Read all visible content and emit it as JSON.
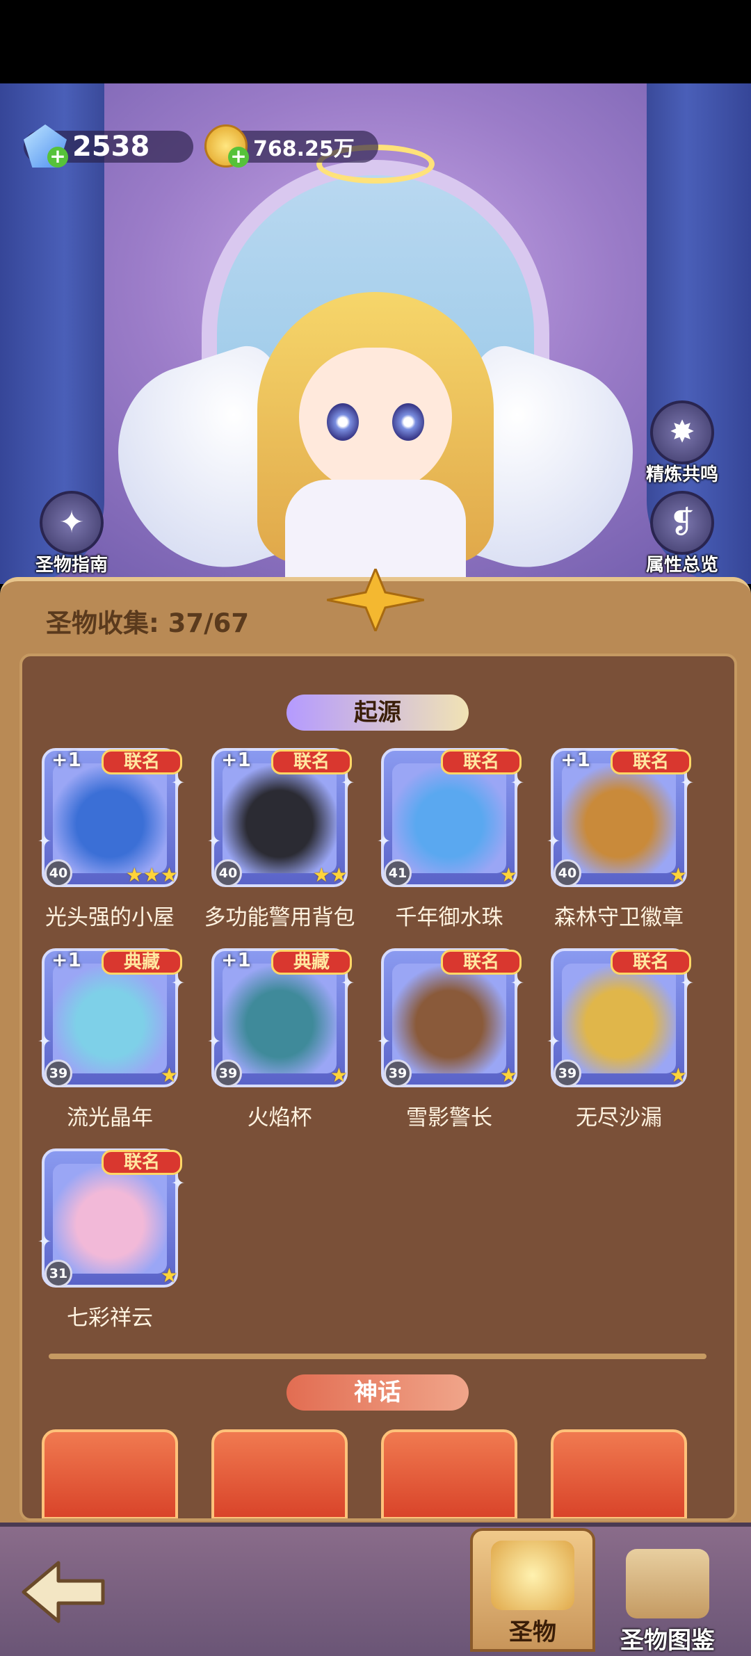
{
  "currency": {
    "diamonds": "2538",
    "coins": "768.25万"
  },
  "side_buttons": {
    "guide": "圣物指南",
    "resonance": "精炼共鸣",
    "overview": "属性总览"
  },
  "collection": {
    "label": "圣物收集: 37/67"
  },
  "categories": {
    "origin": "起源",
    "myth": "神话"
  },
  "items": [
    {
      "name": "光头强的小屋",
      "level": "40",
      "tag": "联名",
      "plus": "+1",
      "stars": "★★★",
      "art_color": "#3b6fd6"
    },
    {
      "name": "多功能警用背包",
      "level": "40",
      "tag": "联名",
      "plus": "+1",
      "stars": "★★",
      "art_color": "#2b2b33"
    },
    {
      "name": "千年御水珠",
      "level": "41",
      "tag": "联名",
      "plus": "",
      "stars": "★",
      "art_color": "#5aa8f0"
    },
    {
      "name": "森林守卫徽章",
      "level": "40",
      "tag": "联名",
      "plus": "+1",
      "stars": "★",
      "art_color": "#c98a3a"
    },
    {
      "name": "流光晶年",
      "level": "39",
      "tag": "典藏",
      "plus": "+1",
      "stars": "★",
      "art_color": "#7ed0e8"
    },
    {
      "name": "火焰杯",
      "level": "39",
      "tag": "典藏",
      "plus": "+1",
      "stars": "★",
      "art_color": "#3f8a9a"
    },
    {
      "name": "雪影警长",
      "level": "39",
      "tag": "联名",
      "plus": "",
      "stars": "★",
      "art_color": "#8a5a3a"
    },
    {
      "name": "无尽沙漏",
      "level": "39",
      "tag": "联名",
      "plus": "",
      "stars": "★",
      "art_color": "#e0b64a"
    },
    {
      "name": "七彩祥云",
      "level": "31",
      "tag": "联名",
      "plus": "",
      "stars": "★",
      "art_color": "#f2b9d8"
    }
  ],
  "tabs": {
    "relic": "圣物",
    "atlas": "圣物图鉴"
  },
  "colors": {
    "panel": "#b98a55",
    "inner": "#7a5038",
    "tag_red": "#d9372f",
    "star": "#ffd43a"
  }
}
